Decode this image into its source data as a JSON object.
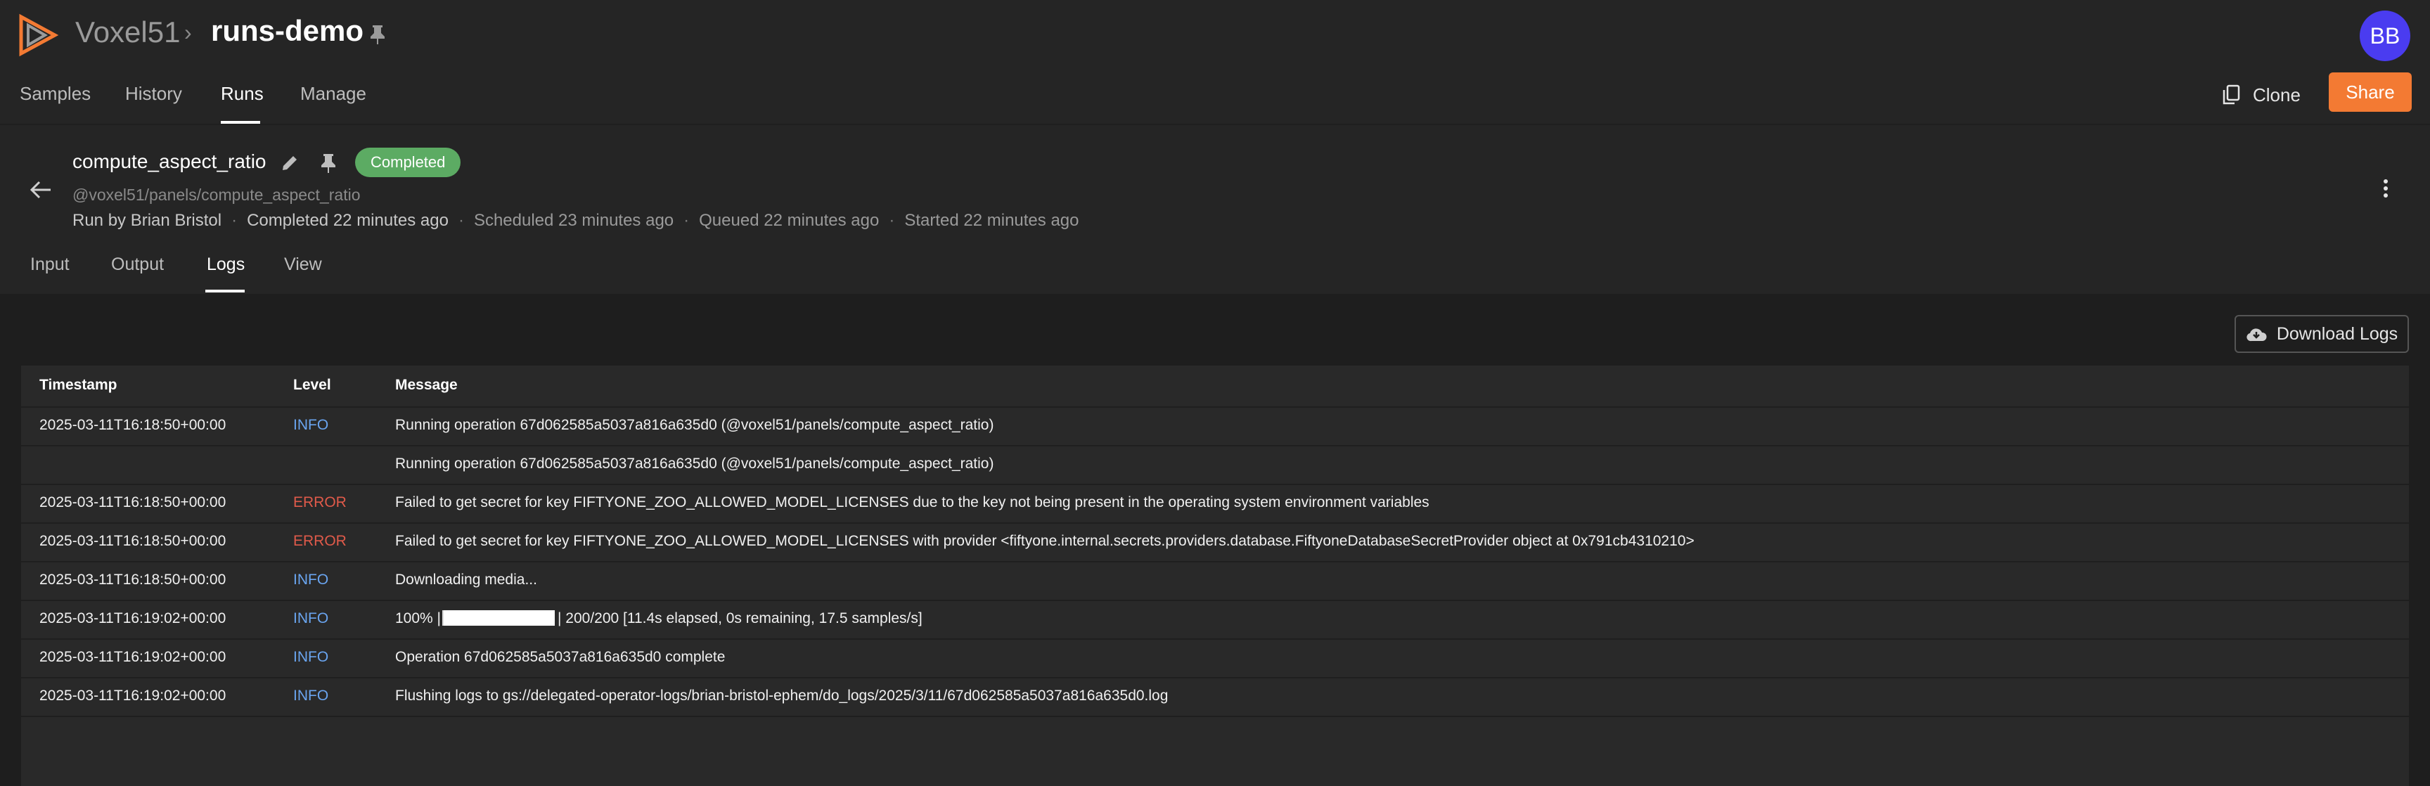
{
  "header": {
    "brand": "Voxel51",
    "separator": "›",
    "dataset": "runs-demo",
    "avatar_initials": "BB"
  },
  "nav": {
    "tabs": [
      {
        "label": "Samples"
      },
      {
        "label": "History"
      },
      {
        "label": "Runs",
        "active": true
      },
      {
        "label": "Manage"
      }
    ],
    "clone_label": "Clone",
    "share_label": "Share"
  },
  "run": {
    "name": "compute_aspect_ratio",
    "status": "Completed",
    "uri": "@voxel51/panels/compute_aspect_ratio",
    "run_by": "Run by Brian Bristol",
    "completed": "Completed 22 minutes ago",
    "scheduled": "Scheduled 23 minutes ago",
    "queued": "Queued 22 minutes ago",
    "started": "Started 22 minutes ago",
    "meta_separator": "·"
  },
  "subtabs": [
    {
      "label": "Input"
    },
    {
      "label": "Output"
    },
    {
      "label": "Logs",
      "active": true
    },
    {
      "label": "View"
    }
  ],
  "logs": {
    "download_label": "Download Logs",
    "columns": [
      "Timestamp",
      "Level",
      "Message"
    ],
    "rows": [
      {
        "timestamp": "2025-03-11T16:18:50+00:00",
        "level": "INFO",
        "message": "Running operation 67d062585a5037a816a635d0 (@voxel51/panels/compute_aspect_ratio)"
      },
      {
        "timestamp": "",
        "level": "",
        "message": "Running operation 67d062585a5037a816a635d0 (@voxel51/panels/compute_aspect_ratio)"
      },
      {
        "timestamp": "2025-03-11T16:18:50+00:00",
        "level": "ERROR",
        "message": "Failed to get secret for key FIFTYONE_ZOO_ALLOWED_MODEL_LICENSES due to the key not being present in the operating system environment variables"
      },
      {
        "timestamp": "2025-03-11T16:18:50+00:00",
        "level": "ERROR",
        "message": "Failed to get secret for key FIFTYONE_ZOO_ALLOWED_MODEL_LICENSES with provider <fiftyone.internal.secrets.providers.database.FiftyoneDatabaseSecretProvider object at 0x791cb4310210>"
      },
      {
        "timestamp": "2025-03-11T16:18:50+00:00",
        "level": "INFO",
        "message": "Downloading media..."
      },
      {
        "timestamp": "2025-03-11T16:19:02+00:00",
        "level": "INFO",
        "message_prefix": "100% |",
        "message_suffix": "| 200/200 [11.4s elapsed, 0s remaining, 17.5 samples/s]",
        "progress": 1.0
      },
      {
        "timestamp": "2025-03-11T16:19:02+00:00",
        "level": "INFO",
        "message": "Operation 67d062585a5037a816a635d0 complete"
      },
      {
        "timestamp": "2025-03-11T16:19:02+00:00",
        "level": "INFO",
        "message": "Flushing logs to gs://delegated-operator-logs/brian-bristol-ephem/do_logs/2025/3/11/67d062585a5037a816a635d0.log"
      }
    ]
  },
  "colors": {
    "accent": "#f37a33",
    "status_completed": "#5cab63",
    "info": "#6aa5f0",
    "error": "#e05a4a",
    "avatar": "#4a3cf0"
  },
  "icons": [
    "voxel51-logo-icon",
    "pin-icon",
    "copy-icon",
    "arrow-left-icon",
    "edit-icon",
    "more-vert-icon",
    "cloud-download-icon"
  ]
}
